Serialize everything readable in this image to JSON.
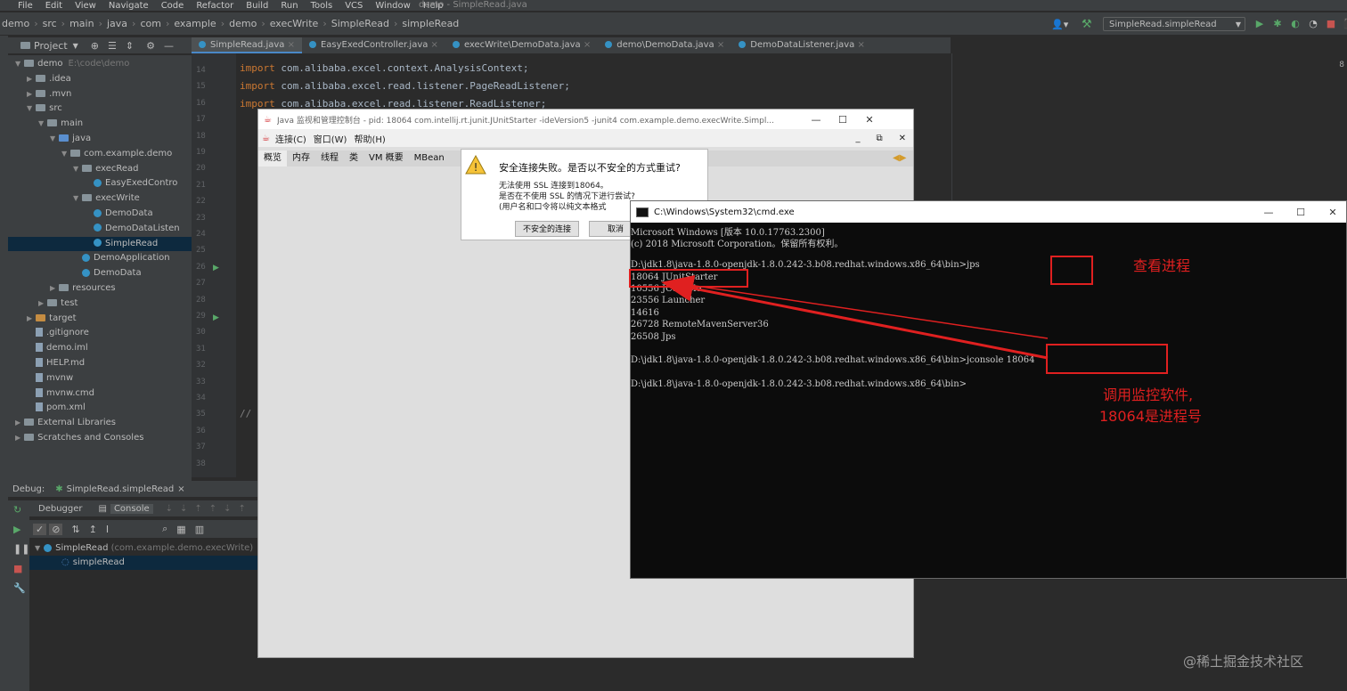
{
  "window_title": "demo - SimpleRead.java",
  "menu": [
    "File",
    "Edit",
    "View",
    "Navigate",
    "Code",
    "Refactor",
    "Build",
    "Run",
    "Tools",
    "VCS",
    "Window",
    "Help"
  ],
  "breadcrumbs": [
    "demo",
    "src",
    "main",
    "java",
    "com",
    "example",
    "demo",
    "execWrite",
    "SimpleRead",
    "simpleRead"
  ],
  "run_config": "SimpleRead.simpleRead",
  "project_panel": {
    "title": "Project",
    "tree": [
      {
        "label": "demo",
        "extra": "E:\\code\\demo",
        "type": "folder",
        "level": 0,
        "open": true
      },
      {
        "label": ".idea",
        "type": "folder",
        "level": 1
      },
      {
        "label": ".mvn",
        "type": "folder",
        "level": 1
      },
      {
        "label": "src",
        "type": "folder",
        "level": 1,
        "open": true
      },
      {
        "label": "main",
        "type": "folder",
        "level": 2,
        "open": true
      },
      {
        "label": "java",
        "type": "folder-blue",
        "level": 3,
        "open": true
      },
      {
        "label": "com.example.demo",
        "type": "folder",
        "level": 4,
        "open": true
      },
      {
        "label": "execRead",
        "type": "folder",
        "level": 5,
        "open": true
      },
      {
        "label": "EasyExedContro",
        "type": "class",
        "level": 6
      },
      {
        "label": "execWrite",
        "type": "folder",
        "level": 5,
        "open": true
      },
      {
        "label": "DemoData",
        "type": "class",
        "level": 6
      },
      {
        "label": "DemoDataListen",
        "type": "class",
        "level": 6
      },
      {
        "label": "SimpleRead",
        "type": "class",
        "level": 6,
        "selected": true
      },
      {
        "label": "DemoApplication",
        "type": "class",
        "level": 5
      },
      {
        "label": "DemoData",
        "type": "class",
        "level": 5
      },
      {
        "label": "resources",
        "type": "folder",
        "level": 3
      },
      {
        "label": "test",
        "type": "folder",
        "level": 2
      },
      {
        "label": "target",
        "type": "folder-orange",
        "level": 1
      },
      {
        "label": ".gitignore",
        "type": "file",
        "level": 1
      },
      {
        "label": "demo.iml",
        "type": "file",
        "level": 1
      },
      {
        "label": "HELP.md",
        "type": "file",
        "level": 1
      },
      {
        "label": "mvnw",
        "type": "file",
        "level": 1
      },
      {
        "label": "mvnw.cmd",
        "type": "file",
        "level": 1
      },
      {
        "label": "pom.xml",
        "type": "file",
        "level": 1
      },
      {
        "label": "External Libraries",
        "type": "folder",
        "level": 0
      },
      {
        "label": "Scratches and Consoles",
        "type": "folder",
        "level": 0
      }
    ]
  },
  "editor_tabs": [
    "SimpleRead.java",
    "EasyExedController.java",
    "execWrite\\DemoData.java",
    "demo\\DemoData.java",
    "DemoDataListener.java"
  ],
  "line_numbers": [
    "14",
    "15",
    "16",
    "17",
    "18",
    "19",
    "20",
    "21",
    "22",
    "23",
    "24",
    "25",
    "26",
    "27",
    "28",
    "29",
    "30",
    "31",
    "32",
    "33",
    "34",
    "35",
    "36",
    "37",
    "38"
  ],
  "code_lines": [
    {
      "kw": "import",
      "text": " com.alibaba.excel.context.AnalysisContext;"
    },
    {
      "kw": "import",
      "text": " com.alibaba.excel.read.listener.PageReadListener;"
    },
    {
      "kw": "import",
      "text": " com.alibaba.excel.read.listener.ReadListener;"
    }
  ],
  "code_comment": "//",
  "gutter_marker": "8",
  "debug": {
    "label": "Debug:",
    "session": "SimpleRead.simpleRead",
    "tabs": [
      "Debugger",
      "Console"
    ],
    "tree": [
      {
        "label": "SimpleRead",
        "extra": "(com.example.demo.execWrite)"
      },
      {
        "label": "simpleRead"
      }
    ]
  },
  "jconsole": {
    "title": "Java 监视和管理控制台 - pid: 18064 com.intellij.rt.junit.JUnitStarter -ideVersion5 -junit4 com.example.demo.execWrite.Simpl...",
    "menu": [
      "连接(C)",
      "窗口(W)",
      "帮助(H)"
    ],
    "tabs": [
      "概览",
      "内存",
      "线程",
      "类",
      "VM 概要",
      "MBean"
    ]
  },
  "ssl_dialog": {
    "heading": "安全连接失败。是否以不安全的方式重试?",
    "lines": [
      "无法使用 SSL 连接到18064。",
      "是否在不使用 SSL 的情况下进行尝试?",
      "(用户名和口令将以纯文本格式"
    ],
    "btn_insecure": "不安全的连接",
    "btn_cancel": "取消"
  },
  "cmd": {
    "title": "C:\\Windows\\System32\\cmd.exe",
    "lines": [
      "Microsoft Windows [版本 10.0.17763.2300]",
      "(c) 2018 Microsoft Corporation。保留所有权利。",
      "",
      "D:\\jdk1.8\\java-1.8.0-openjdk-1.8.0.242-3.b08.redhat.windows.x86_64\\bin>jps",
      "18064 JUnitStarter",
      "10556 JConsole",
      "23556 Launcher",
      "14616",
      "26728 RemoteMavenServer36",
      "26508 Jps",
      "",
      "D:\\jdk1.8\\java-1.8.0-openjdk-1.8.0.242-3.b08.redhat.windows.x86_64\\bin>jconsole 18064",
      "",
      "D:\\jdk1.8\\java-1.8.0-openjdk-1.8.0.242-3.b08.redhat.windows.x86_64\\bin>"
    ]
  },
  "annotations": {
    "view_process": "查看进程",
    "call_monitor_1": "调用监控软件,",
    "call_monitor_2": "18064是进程号"
  },
  "watermark": "@稀土掘金技术社区",
  "colors": {
    "annotation_red": "#e02020",
    "ide_bg": "#2b2b2b",
    "selection": "#0d293e"
  }
}
